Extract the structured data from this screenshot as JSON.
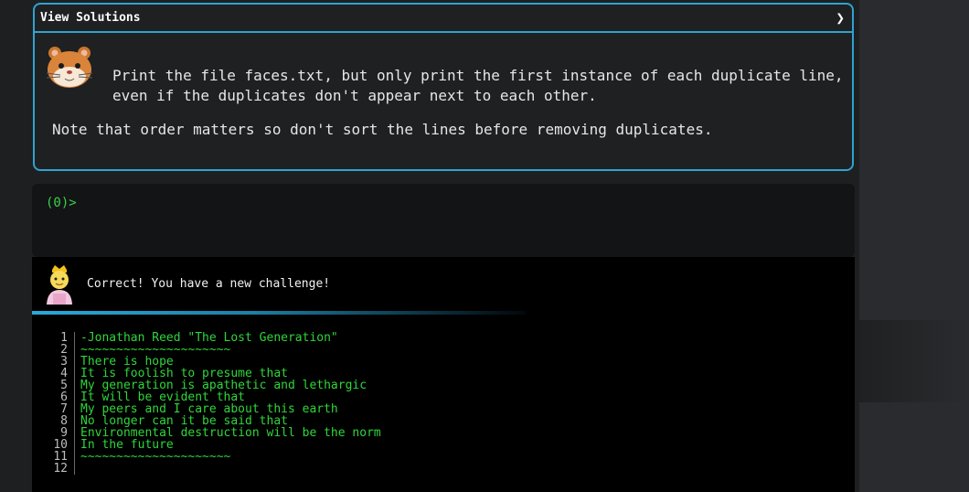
{
  "card": {
    "header_title": "View Solutions",
    "chevron_icon": "chevron-right-icon",
    "avatar_icon": "hamster-icon",
    "task": "Print the file faces.txt, but only print the first instance of each duplicate line,\neven if the duplicates don't appear next to each other.",
    "note": "Note that order matters so don't sort the lines before removing duplicates."
  },
  "terminal": {
    "prompt": "(0)>"
  },
  "output": {
    "avatar_icon": "princess-icon",
    "message": "Correct! You have a new challenge!",
    "lines": [
      {
        "n": "1",
        "text": "-Jonathan Reed \"The Lost Generation\""
      },
      {
        "n": "2",
        "text": "~~~~~~~~~~~~~~~~~~~~~"
      },
      {
        "n": "3",
        "text": "There is hope"
      },
      {
        "n": "4",
        "text": "It is foolish to presume that"
      },
      {
        "n": "5",
        "text": "My generation is apathetic and lethargic"
      },
      {
        "n": "6",
        "text": "It will be evident that"
      },
      {
        "n": "7",
        "text": "My peers and I care about this earth"
      },
      {
        "n": "8",
        "text": "No longer can it be said that"
      },
      {
        "n": "9",
        "text": "Environmental destruction will be the norm"
      },
      {
        "n": "10",
        "text": "In the future"
      },
      {
        "n": "11",
        "text": "~~~~~~~~~~~~~~~~~~~~~"
      },
      {
        "n": "12",
        "text": ""
      }
    ]
  },
  "colors": {
    "accent": "#2fa3cf",
    "prompt_green": "#3ad24a",
    "code_green": "#2fd63a"
  }
}
